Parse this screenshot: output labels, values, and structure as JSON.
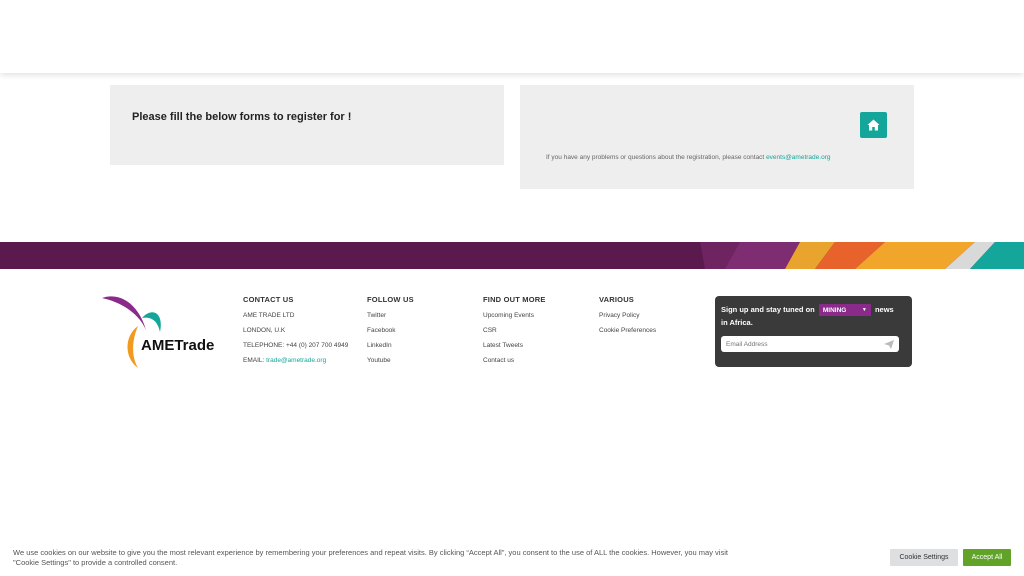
{
  "register": {
    "heading": "Please fill the below forms to register for !",
    "help_text": "If you have any problems or questions about the registration, please contact ",
    "help_email": "events@ametrade.org",
    "home_icon": "home-icon"
  },
  "footer": {
    "logo_text": "AMETrade",
    "contact": {
      "title": "CONTACT US",
      "company": "AME TRADE LTD",
      "city": "LONDON, U.K",
      "telephone": "TELEPHONE: +44 (0) 207 700 4949",
      "email_label": "EMAIL: ",
      "email": "trade@ametrade.org"
    },
    "follow": {
      "title": "FOLLOW US",
      "items": [
        "Twitter",
        "Facebook",
        "LinkedIn",
        "Youtube"
      ]
    },
    "find_out": {
      "title": "FIND OUT MORE",
      "items": [
        "Upcoming Events",
        "CSR",
        "Latest Tweets",
        "Contact us"
      ]
    },
    "various": {
      "title": "VARIOUS",
      "items": [
        "Privacy Policy",
        "Cookie Preferences"
      ]
    },
    "signup": {
      "text_before": "Sign up and stay tuned on",
      "sector": "MINING",
      "text_after": "news",
      "text_line2": "in Africa.",
      "email_placeholder": "Email Address",
      "send_icon": "send-icon"
    }
  },
  "cookie_banner": {
    "message": "We use cookies on our website to give you the most relevant experience by remembering your preferences and repeat visits. By clicking “Accept All”, you consent to the use of ALL the cookies. However, you may visit \"Cookie Settings\" to provide a controlled consent.",
    "settings_label": "Cookie Settings",
    "accept_label": "Accept All"
  },
  "colors": {
    "accent": "#14a69a",
    "band": "#5b1a4d",
    "sector_select": "#8a2a8a",
    "accept": "#61a229"
  }
}
